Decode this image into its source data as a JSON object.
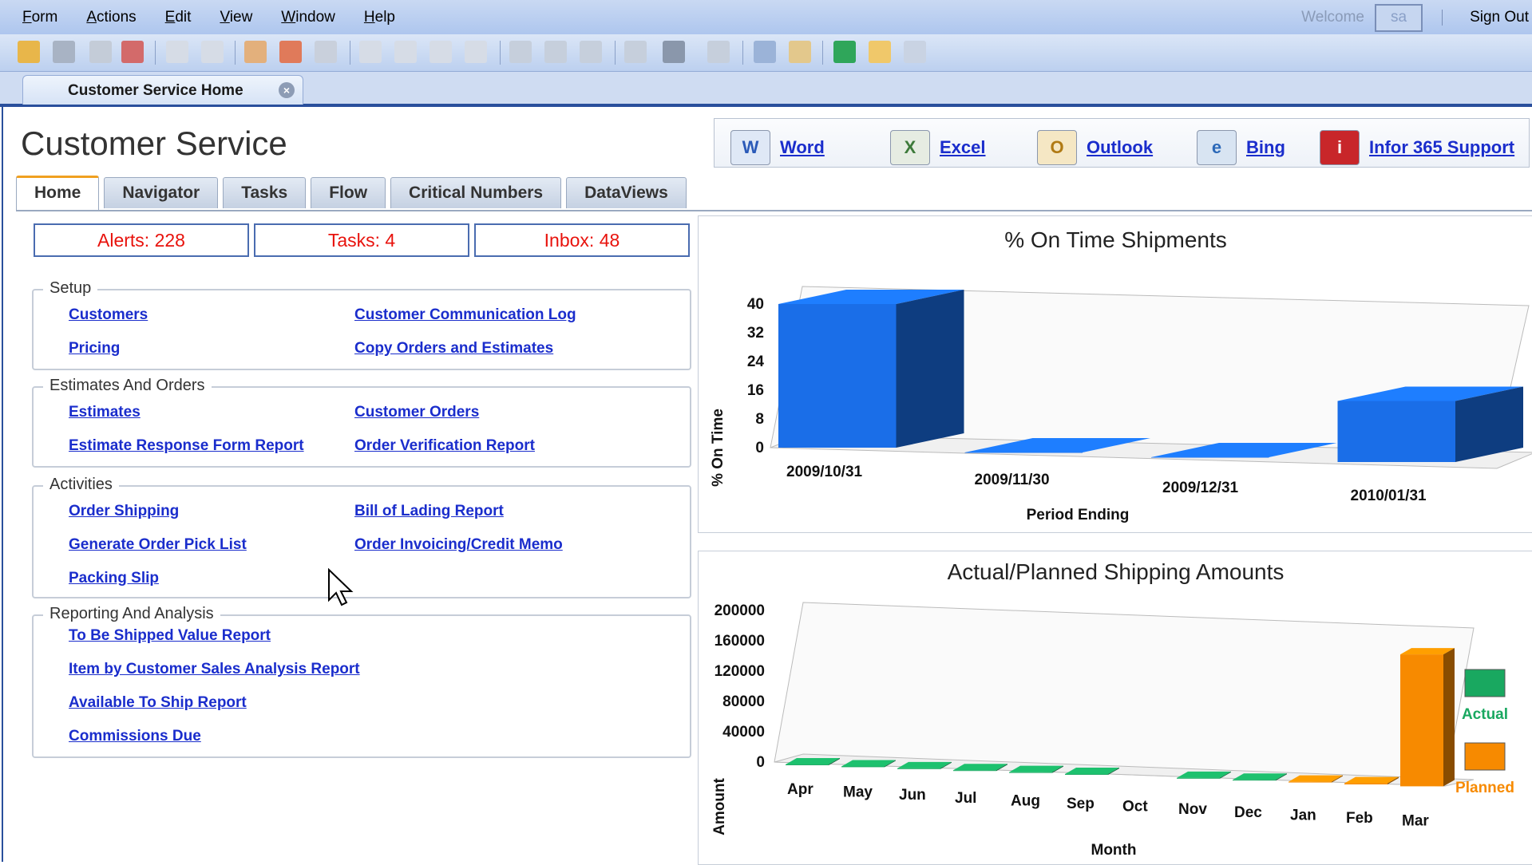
{
  "menu": [
    "Form",
    "Actions",
    "Edit",
    "View",
    "Window",
    "Help"
  ],
  "header": {
    "welcome": "Welcome",
    "user": "sa",
    "signout": "Sign Out"
  },
  "doc_tab": {
    "title": "Customer Service Home"
  },
  "page": {
    "title": "Customer Service"
  },
  "office_links": [
    {
      "label": "Word",
      "icon": "word-icon"
    },
    {
      "label": "Excel",
      "icon": "excel-icon"
    },
    {
      "label": "Outlook",
      "icon": "outlook-icon"
    },
    {
      "label": "Bing",
      "icon": "bing-icon"
    },
    {
      "label": "Infor 365 Support",
      "icon": "infor-support-icon"
    }
  ],
  "tabs": [
    "Home",
    "Navigator",
    "Tasks",
    "Flow",
    "Critical Numbers",
    "DataViews"
  ],
  "counters": {
    "alerts": "Alerts: 228",
    "tasks": "Tasks: 4",
    "inbox": "Inbox: 48"
  },
  "groups": {
    "setup": {
      "title": "Setup",
      "links": [
        "Customers",
        "Customer Communication Log",
        "Pricing",
        "Copy Orders and Estimates"
      ]
    },
    "estimates": {
      "title": "Estimates And Orders",
      "links": [
        "Estimates",
        "Customer Orders",
        "Estimate Response Form Report",
        "Order Verification Report"
      ]
    },
    "activities": {
      "title": "Activities",
      "links": [
        "Order Shipping",
        "Bill of Lading Report",
        "Generate Order Pick List",
        "Order Invoicing/Credit Memo",
        "Packing Slip"
      ]
    },
    "reporting": {
      "title": "Reporting And Analysis",
      "links": [
        "To Be Shipped Value Report",
        "Item by Customer Sales Analysis Report",
        "Available To Ship Report",
        "Commissions Due"
      ]
    }
  },
  "colors": {
    "link": "#1a2dcc",
    "alert_text": "#e8120c",
    "bar_blue": "#1a6ee8",
    "actual_green": "#19a860",
    "planned_orange": "#f78a00"
  },
  "chart_data": [
    {
      "type": "bar",
      "title": "% On Time Shipments",
      "xlabel": "Period Ending",
      "ylabel": "% On Time",
      "ytick_labels": [
        "0",
        "8",
        "16",
        "24",
        "32",
        "40"
      ],
      "ylim": [
        0,
        40
      ],
      "categories": [
        "2009/10/31",
        "2009/11/30",
        "2009/12/31",
        "2010/01/31"
      ],
      "values": [
        40,
        0,
        0,
        17
      ],
      "grid": false
    },
    {
      "type": "bar",
      "title": "Actual/Planned Shipping Amounts",
      "xlabel": "Month",
      "ylabel": "Amount",
      "ytick_labels": [
        "0",
        "40000",
        "80000",
        "120000",
        "160000",
        "200000"
      ],
      "ylim": [
        0,
        200000
      ],
      "categories": [
        "Apr",
        "May",
        "Jun",
        "Jul",
        "Aug",
        "Sep",
        "Oct",
        "Nov",
        "Dec",
        "Jan",
        "Feb",
        "Mar"
      ],
      "series": [
        {
          "name": "Actual",
          "values": [
            1000,
            1000,
            1000,
            1000,
            1000,
            1000,
            0,
            1000,
            1000,
            0,
            0,
            0
          ]
        },
        {
          "name": "Planned",
          "values": [
            0,
            0,
            0,
            0,
            0,
            0,
            0,
            0,
            0,
            1000,
            1500,
            174000
          ]
        }
      ],
      "legend": "right",
      "grid": false
    }
  ]
}
